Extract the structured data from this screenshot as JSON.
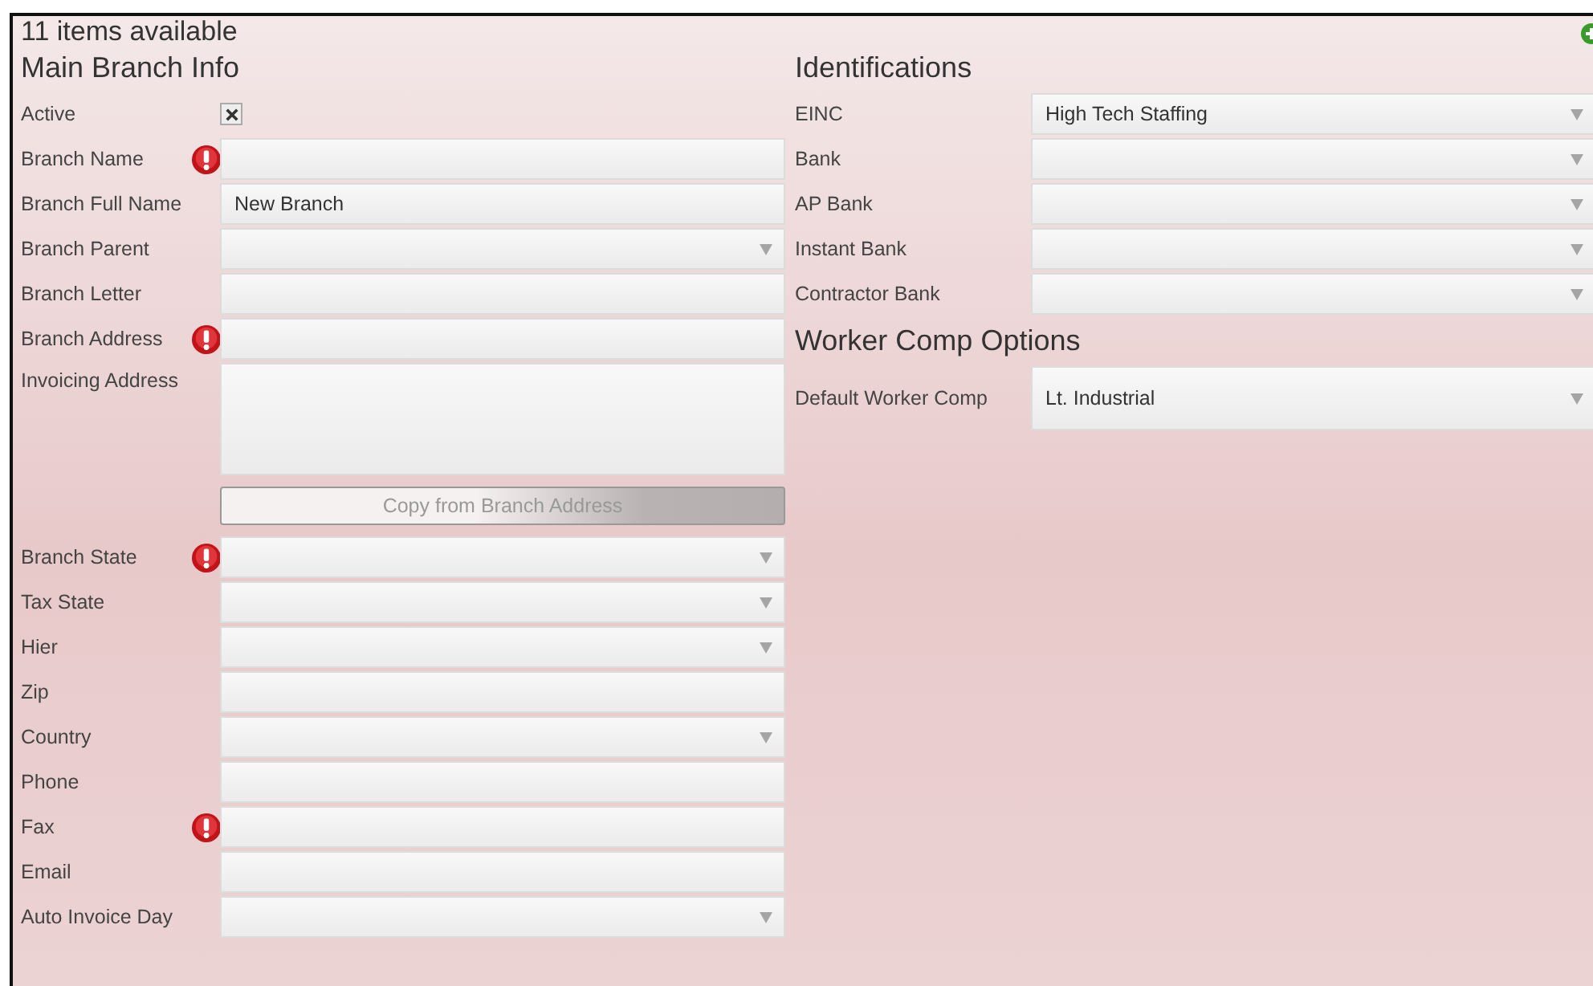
{
  "header": {
    "count_text": "11 items available"
  },
  "left_column": [
    {
      "title": "Main Branch Info",
      "fields": [
        {
          "label": "Active",
          "kind": "checkbox",
          "checked": true,
          "error": false
        },
        {
          "label": "Branch Name",
          "kind": "text",
          "error": true
        },
        {
          "label": "Branch Full Name",
          "kind": "text",
          "value": "New Branch",
          "error": false
        },
        {
          "label": "Branch Parent",
          "kind": "dropdown",
          "error": false
        },
        {
          "label": "Branch Letter",
          "kind": "text",
          "error": false
        },
        {
          "label": "Branch Address",
          "kind": "text",
          "error": true
        },
        {
          "label": "Invoicing Address",
          "kind": "textarea",
          "error": false
        },
        {
          "kind": "button",
          "text": "Copy from Branch Address",
          "disabled": true,
          "error": false
        },
        {
          "label": "Branch State",
          "kind": "dropdown",
          "error": true
        },
        {
          "label": "Tax State",
          "kind": "dropdown",
          "error": false
        },
        {
          "label": "Hier",
          "kind": "dropdown",
          "error": false
        },
        {
          "label": "Zip",
          "kind": "text",
          "error": false
        },
        {
          "label": "Country",
          "kind": "dropdown",
          "error": false
        },
        {
          "label": "Phone",
          "kind": "text",
          "error": false
        },
        {
          "label": "Fax",
          "kind": "text",
          "error": true
        },
        {
          "label": "Email",
          "kind": "text",
          "error": false
        },
        {
          "label": "Auto Invoice Day",
          "kind": "dropdown",
          "error": false
        }
      ]
    }
  ],
  "right_column": [
    {
      "title": "Identifications",
      "fields": [
        {
          "label": "EINC",
          "kind": "dropdown",
          "value": "High Tech Staffing",
          "error": false
        },
        {
          "label": "Bank",
          "kind": "dropdown",
          "error": false
        },
        {
          "label": "AP Bank",
          "kind": "dropdown",
          "error": false
        },
        {
          "label": "Instant Bank",
          "kind": "dropdown",
          "error": false
        },
        {
          "label": "Contractor Bank",
          "kind": "dropdown",
          "error": false
        }
      ]
    },
    {
      "title": "Worker Comp Options",
      "fields": [
        {
          "label": "Default Worker Comp",
          "kind": "dropdown",
          "tall": true,
          "value": "Lt. Industrial",
          "error": false
        }
      ]
    }
  ]
}
